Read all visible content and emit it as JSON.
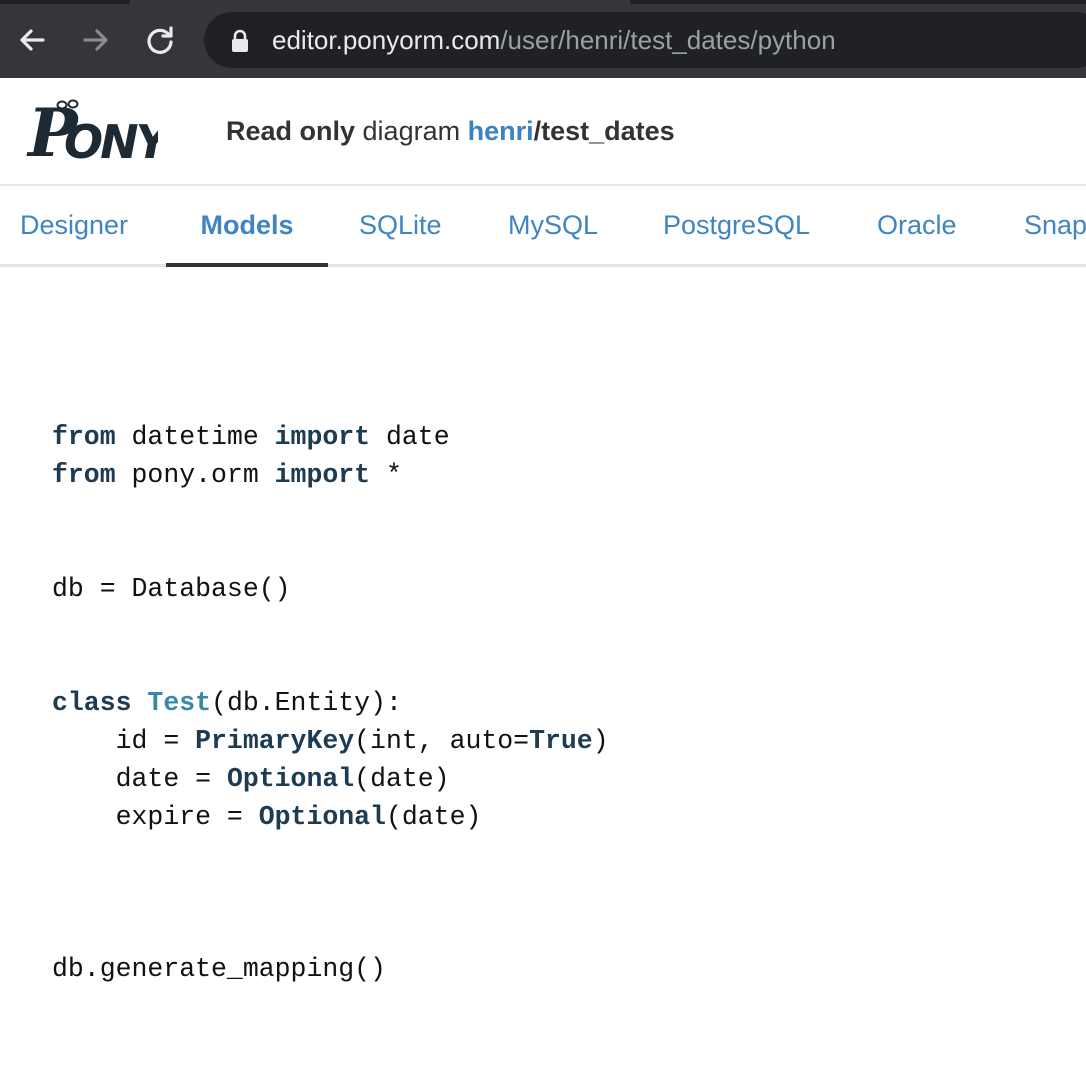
{
  "browser": {
    "url_host": "editor.ponyorm.com",
    "url_path": "/user/henri/test_dates/python",
    "icons": {
      "back": "arrow-left-icon",
      "forward": "arrow-right-icon",
      "reload": "reload-icon",
      "secure": "lock-icon"
    }
  },
  "header": {
    "logo_text": "PONY",
    "read_only": "Read only",
    "diagram_word": " diagram ",
    "user": "henri",
    "separator": "/",
    "diagram_name": "test_dates"
  },
  "tabs": [
    {
      "label": "Designer"
    },
    {
      "label": "Models",
      "active": true
    },
    {
      "label": "SQLite"
    },
    {
      "label": "MySQL"
    },
    {
      "label": "PostgreSQL"
    },
    {
      "label": "Oracle"
    },
    {
      "label": "Snap"
    }
  ],
  "code": {
    "l1": {
      "kw1": "from",
      "t1": " datetime ",
      "kw2": "import",
      "t2": " date"
    },
    "l2": {
      "kw1": "from",
      "t1": " pony.orm ",
      "kw2": "import",
      "t2": " *"
    },
    "l3": {
      "t1": "db = Database()"
    },
    "l4": {
      "kw1": "class",
      "sp": " ",
      "cls": "Test",
      "t1": "(db.Entity):"
    },
    "l5": {
      "t1": "    id = ",
      "fn": "PrimaryKey",
      "t2": "(int, auto=",
      "kw": "True",
      "t3": ")"
    },
    "l6": {
      "t1": "    date = ",
      "fn": "Optional",
      "t2": "(date)"
    },
    "l7": {
      "t1": "    expire = ",
      "fn": "Optional",
      "t2": "(date)"
    },
    "l8": {
      "t1": "db.generate_mapping()"
    }
  }
}
